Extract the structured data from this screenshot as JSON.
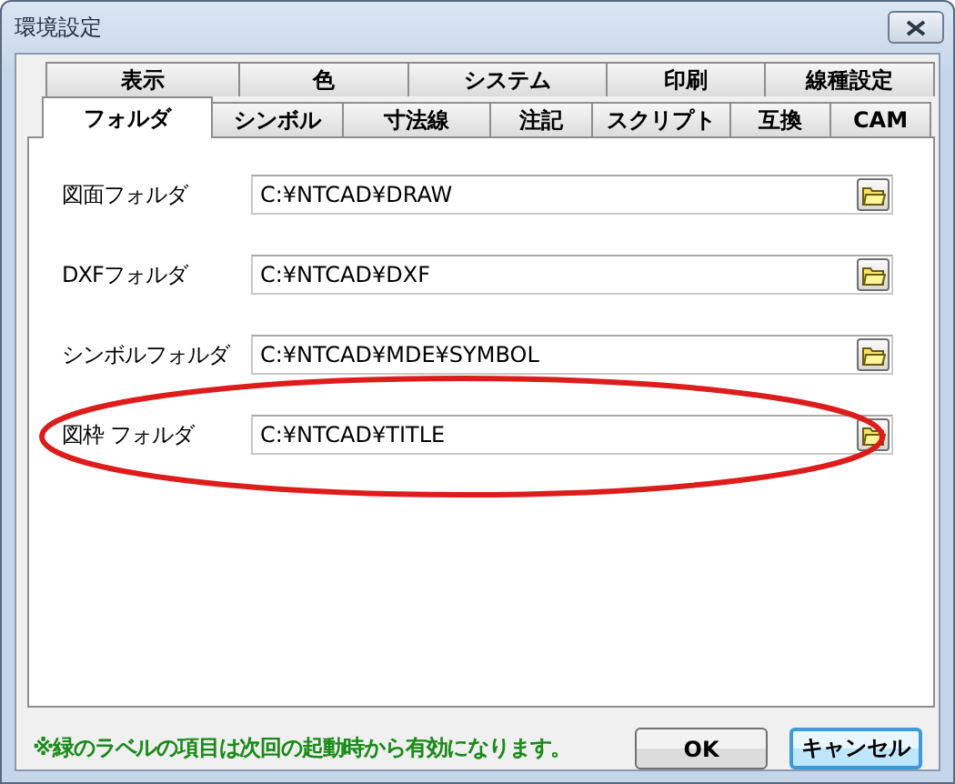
{
  "window": {
    "title": "環境設定"
  },
  "tabs": {
    "back_row": [
      {
        "label": "表示",
        "selected": false
      },
      {
        "label": "色",
        "selected": false
      },
      {
        "label": "システム",
        "selected": false
      },
      {
        "label": "印刷",
        "selected": false
      },
      {
        "label": "線種設定",
        "selected": false
      }
    ],
    "front_row": [
      {
        "label": "フォルダ",
        "selected": true
      },
      {
        "label": "シンボル",
        "selected": false
      },
      {
        "label": "寸法線",
        "selected": false
      },
      {
        "label": "注記",
        "selected": false
      },
      {
        "label": "スクリプト",
        "selected": false
      },
      {
        "label": "互換",
        "selected": false
      },
      {
        "label": "CAM",
        "selected": false
      }
    ]
  },
  "folders": [
    {
      "label": "図面フォルダ",
      "value": "C:¥NTCAD¥DRAW",
      "highlighted": false
    },
    {
      "label": "DXFフォルダ",
      "value": "C:¥NTCAD¥DXF",
      "highlighted": false
    },
    {
      "label": "シンボルフォルダ",
      "value": "C:¥NTCAD¥MDE¥SYMBOL",
      "highlighted": false
    },
    {
      "label": "図枠 フォルダ",
      "value": "C:¥NTCAD¥TITLE",
      "highlighted": true
    }
  ],
  "note": "※緑のラベルの項目は次回の起動時から有効になります。",
  "buttons": [
    {
      "label": "OK",
      "focused": false
    },
    {
      "label": "キャンセル",
      "focused": true
    }
  ]
}
